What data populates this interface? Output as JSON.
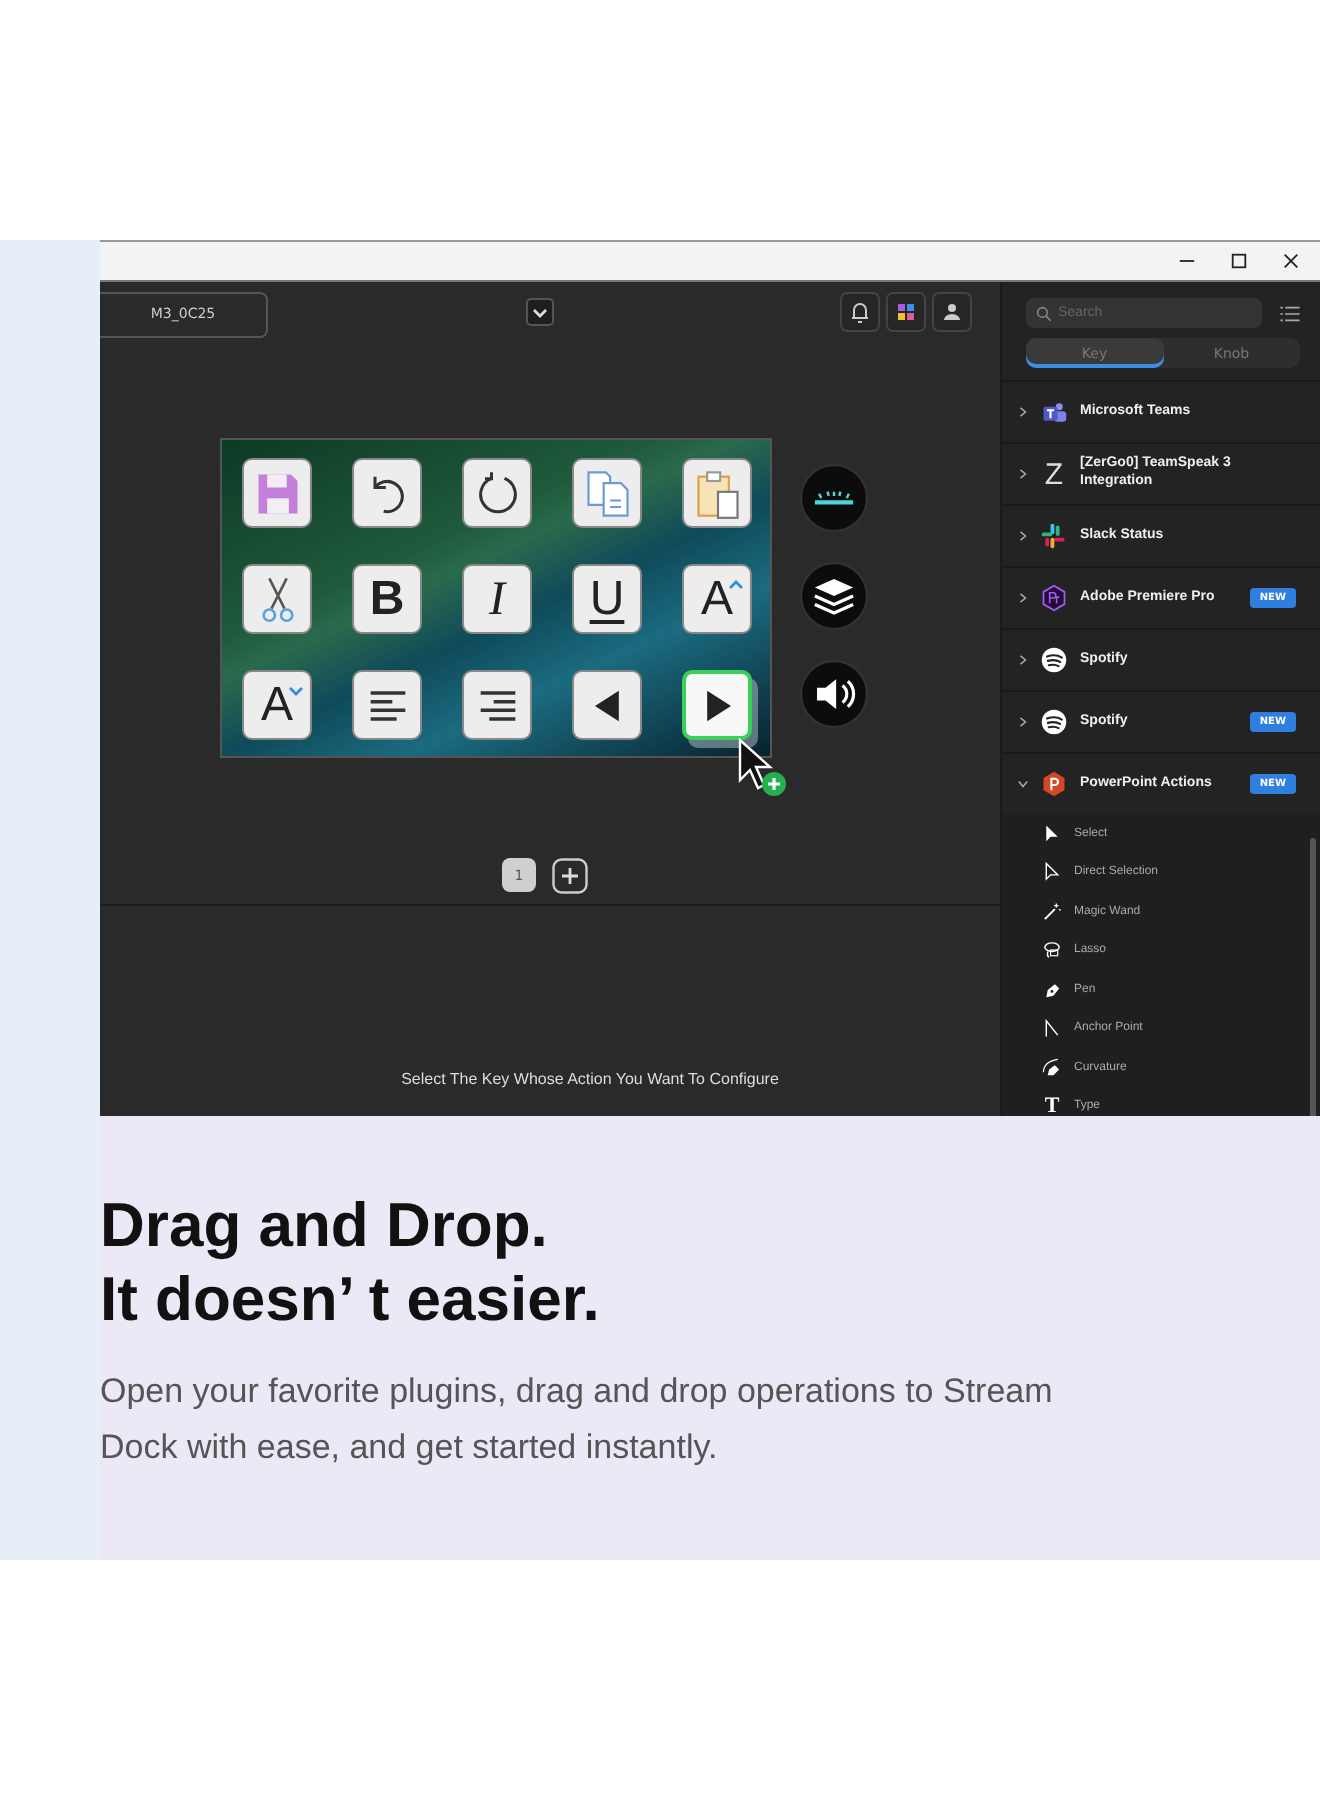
{
  "device": {
    "name": "M3_0C25"
  },
  "keys": [
    {
      "kind": "save",
      "selected": false
    },
    {
      "kind": "undo",
      "selected": false
    },
    {
      "kind": "redo",
      "selected": false
    },
    {
      "kind": "copy",
      "selected": false
    },
    {
      "kind": "paste",
      "selected": false
    },
    {
      "kind": "cut",
      "selected": false
    },
    {
      "kind": "bold",
      "glyph": "B",
      "selected": false
    },
    {
      "kind": "italic",
      "glyph": "I",
      "selected": false
    },
    {
      "kind": "underline",
      "glyph": "U",
      "selected": false
    },
    {
      "kind": "grow",
      "glyph": "A",
      "selected": false
    },
    {
      "kind": "shrink",
      "glyph": "A",
      "selected": false
    },
    {
      "kind": "align-left",
      "selected": false
    },
    {
      "kind": "align-right",
      "selected": false
    },
    {
      "kind": "previous",
      "selected": false
    },
    {
      "kind": "next",
      "selected": true
    }
  ],
  "knobs": [
    {
      "kind": "light"
    },
    {
      "kind": "layers"
    },
    {
      "kind": "volume"
    }
  ],
  "pages": [
    {
      "label": "1",
      "selected": true
    }
  ],
  "hint": "Select The Key Whose Action You Want To Configure",
  "sidebar": {
    "search": {
      "placeholder": "Search"
    },
    "tabs": [
      {
        "label": "Key",
        "selected": true
      },
      {
        "label": "Knob",
        "selected": false
      }
    ],
    "plugins": [
      {
        "kind": "teams",
        "name": "Microsoft Teams",
        "expanded": false
      },
      {
        "kind": "letter",
        "glyph": "Z",
        "name": "[ZerGo0] TeamSpeak 3 Integration",
        "expanded": false
      },
      {
        "kind": "slack",
        "name": "Slack Status",
        "expanded": false
      },
      {
        "kind": "premiere",
        "name": "Adobe Premiere Pro",
        "badge": "NEW",
        "expanded": false
      },
      {
        "kind": "spotify",
        "name": "Spotify",
        "expanded": false
      },
      {
        "kind": "spotify",
        "name": "Spotify",
        "badge": "NEW",
        "expanded": false
      },
      {
        "kind": "powerpoint",
        "name": "PowerPoint Actions",
        "badge": "NEW",
        "expanded": true,
        "children": [
          {
            "kind": "select",
            "label": "Select"
          },
          {
            "kind": "direct",
            "label": "Direct Selection"
          },
          {
            "kind": "wand",
            "label": "Magic Wand"
          },
          {
            "kind": "lasso",
            "label": "Lasso"
          },
          {
            "kind": "pen",
            "label": "Pen"
          },
          {
            "kind": "anchor",
            "label": "Anchor Point"
          },
          {
            "kind": "curvature",
            "label": "Curvature"
          },
          {
            "kind": "type",
            "glyph": "T",
            "label": "Type"
          }
        ]
      }
    ]
  },
  "headline": [
    "Drag and Drop.",
    "It doesn’ t easier."
  ],
  "description": "Open your favorite plugins, drag and drop operations to Stream Dock with ease, and get started instantly."
}
